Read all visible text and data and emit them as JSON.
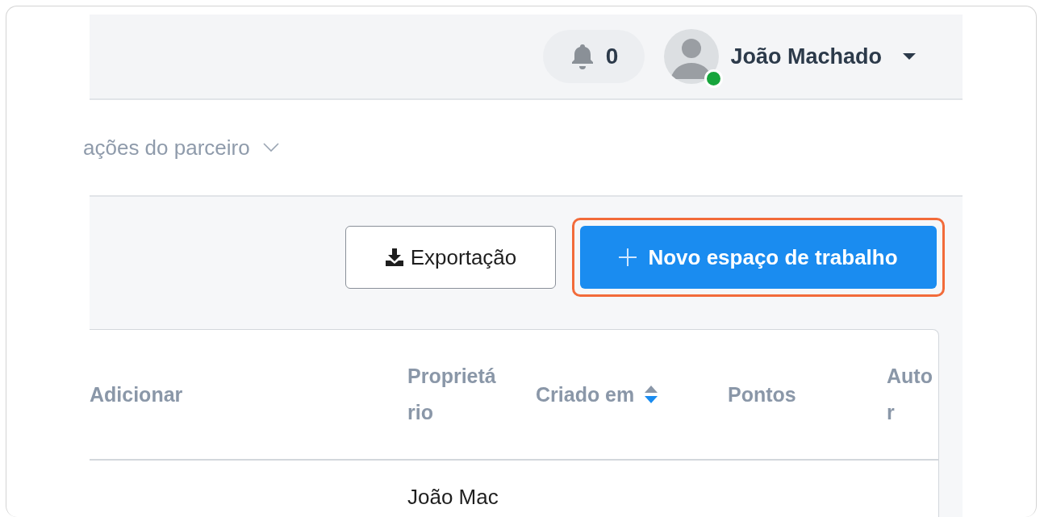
{
  "topbar": {
    "notifications": {
      "count": "0"
    },
    "user": {
      "name": "João Machado",
      "online": true
    }
  },
  "nav_menu": {
    "label": "ações do parceiro"
  },
  "toolbar": {
    "buttons": [
      {
        "kind": "secondary",
        "label": "Exportação",
        "highlighted": false
      },
      {
        "kind": "primary",
        "label": "Novo espaço de trabalho",
        "highlighted": true
      }
    ]
  },
  "table": {
    "columns": [
      {
        "label": "Adicionar",
        "sortable": false
      },
      {
        "label": "Proprietário",
        "sortable": false
      },
      {
        "label": "Criado em",
        "sortable": true
      },
      {
        "label": "Pontos",
        "sortable": false
      },
      {
        "label": "Autor",
        "sortable": false
      }
    ],
    "rows": [
      {
        "owner": "João Mac"
      }
    ]
  }
}
